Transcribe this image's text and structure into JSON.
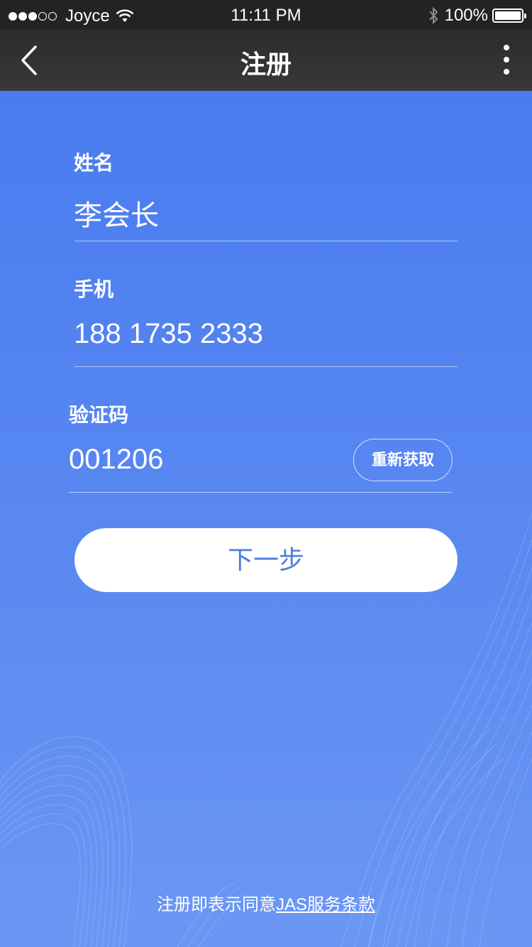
{
  "status_bar": {
    "carrier": "Joyce",
    "time": "11:11 PM",
    "battery": "100%"
  },
  "nav": {
    "title": "注册",
    "back_icon": "chevron-left-icon",
    "more_icon": "more-vertical-icon"
  },
  "form": {
    "name_label": "姓名",
    "name_value": "李会长",
    "phone_label": "手机",
    "phone_value": "188 1735 2333",
    "code_label": "验证码",
    "code_value": "001206",
    "resend_label": "重新获取"
  },
  "next_button": "下一步",
  "terms": {
    "prefix": "注册即表示同意",
    "link": "JAS服务条款"
  },
  "colors": {
    "background": "#4b7ef0",
    "nav_bar": "#2c2c2f",
    "button_text": "#4f7fdc"
  }
}
